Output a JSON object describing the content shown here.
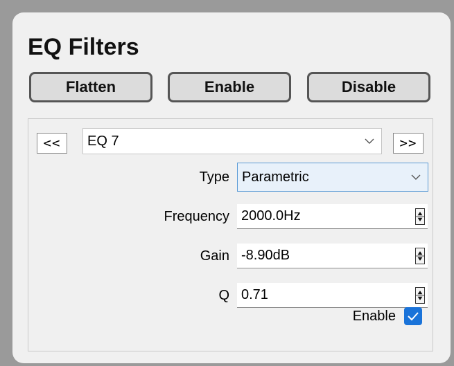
{
  "panel": {
    "title": "EQ Filters"
  },
  "buttons": {
    "flatten": "Flatten",
    "enable": "Enable",
    "disable": "Disable"
  },
  "nav": {
    "prev": "<<",
    "next": ">>",
    "selected_filter": "EQ 7"
  },
  "fields": {
    "type_label": "Type",
    "type_value": "Parametric",
    "frequency_label": "Frequency",
    "frequency_value": "2000.0Hz",
    "gain_label": "Gain",
    "gain_value": "-8.90dB",
    "q_label": "Q",
    "q_value": "0.71",
    "enable_label": "Enable",
    "enable_checked": true
  },
  "colors": {
    "accent": "#1a73d9",
    "selected_bg": "#e8f1fa"
  }
}
